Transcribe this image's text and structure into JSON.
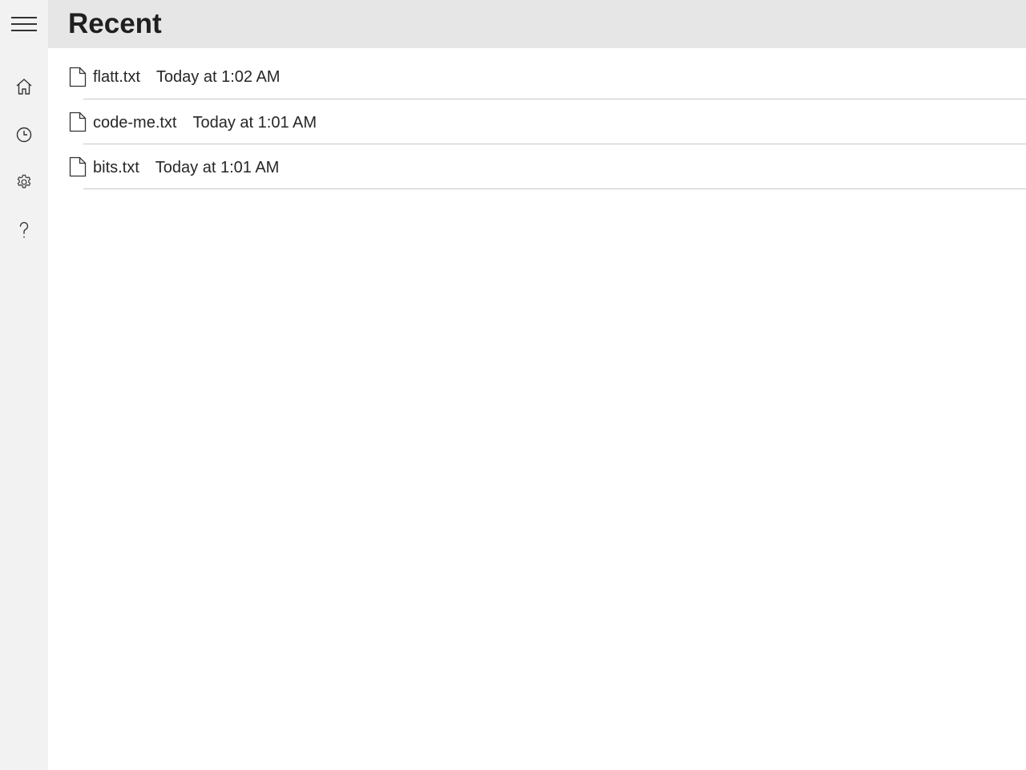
{
  "header": {
    "title": "Recent"
  },
  "nav": {
    "items": [
      {
        "icon": "hamburger-menu-icon"
      },
      {
        "icon": "home-icon"
      },
      {
        "icon": "clock-icon"
      },
      {
        "icon": "gear-icon"
      },
      {
        "icon": "help-icon"
      }
    ]
  },
  "recent_files": [
    {
      "name": "flatt.txt",
      "modified": "Today at 1:02 AM",
      "icon": "document-icon"
    },
    {
      "name": "code-me.txt",
      "modified": "Today at 1:01 AM",
      "icon": "document-icon"
    },
    {
      "name": "bits.txt",
      "modified": "Today at 1:01 AM",
      "icon": "document-icon"
    }
  ]
}
